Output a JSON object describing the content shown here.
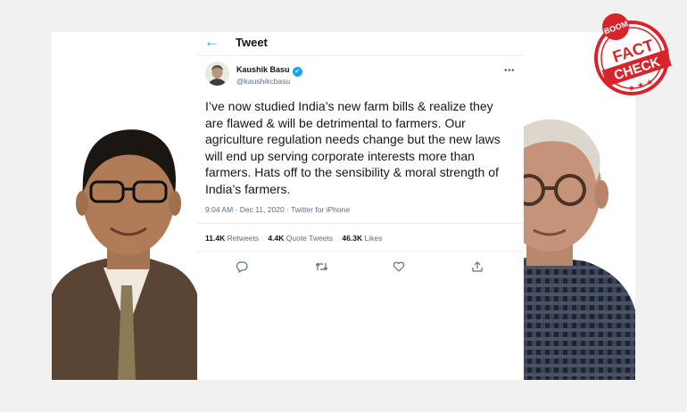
{
  "header": {
    "title": "Tweet"
  },
  "author": {
    "name": "Kaushik Basu",
    "handle": "@kaushikcbasu",
    "verified_glyph": "✓"
  },
  "tweet": {
    "text": "I’ve now studied India’s new farm bills & realize they are flawed & will be detrimental to farmers. Our agriculture regulation needs change but the new laws will end up serving corporate interests more than farmers. Hats off to the sensibility & moral strength of India’s farmers.",
    "meta": "9:04 AM · Dec 11, 2020 · Twitter for iPhone"
  },
  "stats": {
    "retweets_count": "11.4K",
    "retweets_label": "Retweets",
    "quotes_count": "4.4K",
    "quotes_label": "Quote Tweets",
    "likes_count": "46.3K",
    "likes_label": "Likes"
  },
  "icons": [
    "back-arrow-icon",
    "verified-icon",
    "more-icon",
    "reply-icon",
    "retweet-icon",
    "like-icon",
    "share-icon"
  ],
  "badge": {
    "brand": "BOOM",
    "line1": "FACT",
    "line2": "CHECK"
  },
  "colors": {
    "accent": "#1da1f2",
    "badge_red": "#d8232a"
  }
}
